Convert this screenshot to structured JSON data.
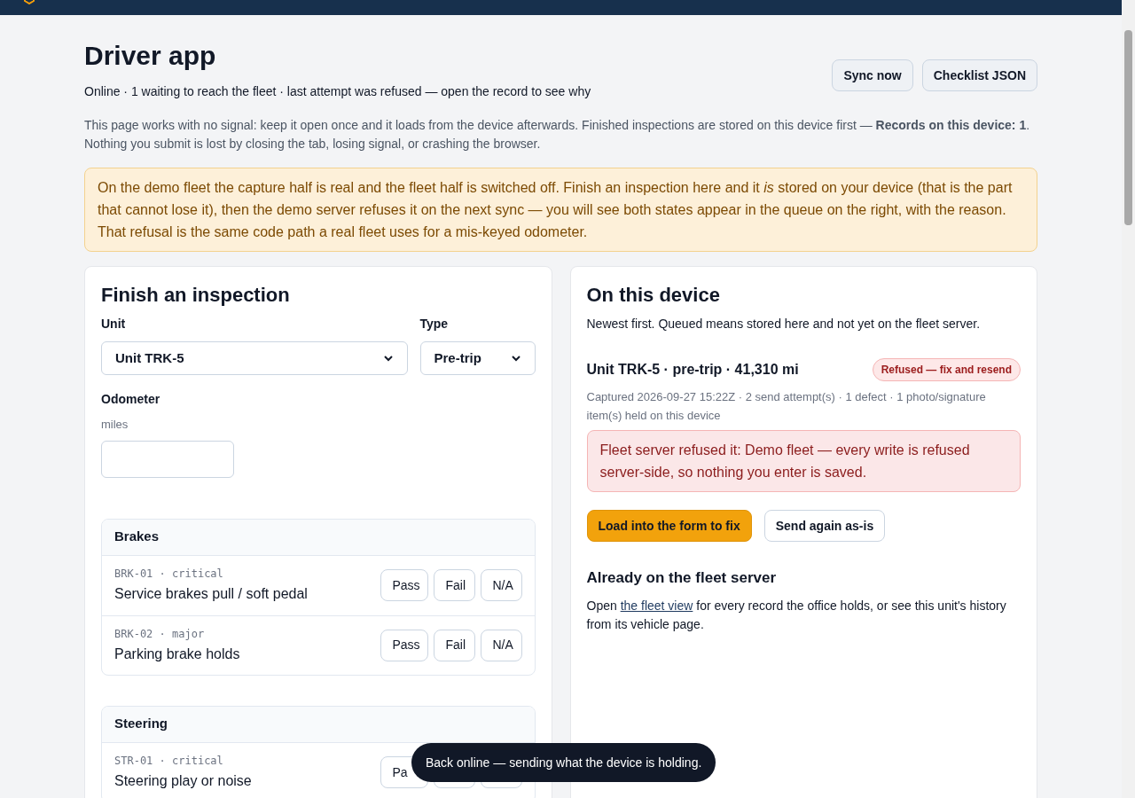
{
  "header": {
    "title": "Driver app",
    "status": "Online · 1 waiting to reach the fleet · last attempt was refused — open the record to see why",
    "actions": [
      "Sync now",
      "Checklist JSON"
    ],
    "info": "This page works with no signal: keep it open once and it loads from the device afterwards. Finished inspections are stored on this device first — **Records on this device: 1**. Nothing you submit is lost by closing the tab, losing signal, or crashing the browser."
  },
  "notice": "On the demo fleet the capture half is real and the fleet half is switched off. Finish an inspection here and it *is* stored on your device (that is the part that cannot lose it), then the demo server refuses it on the next sync — you will see both states appear in the queue on the right, with the reason. That refusal is the same code path a real fleet uses for a mis-keyed odometer.",
  "form": {
    "title": "Finish an inspection",
    "unit": {
      "label": "Unit",
      "value": "Unit TRK-5"
    },
    "type": {
      "label": "Type",
      "value": "Pre-trip"
    },
    "odometer": {
      "label": "Odometer",
      "hint": "miles"
    },
    "sections": [
      {
        "title": "Brakes",
        "items": [
          {
            "code": "BRK-01 · critical",
            "text": "Service brakes pull / soft pedal",
            "options": [
              {
                "label": "Pass",
                "selected": false
              },
              {
                "label": "Fail",
                "selected": false
              },
              {
                "label": "N/A",
                "selected": false
              }
            ]
          },
          {
            "code": "BRK-02 · major",
            "text": "Parking brake holds",
            "options": [
              {
                "label": "Pass",
                "selected": false
              },
              {
                "label": "Fail",
                "selected": false
              },
              {
                "label": "N/A",
                "selected": false
              }
            ]
          }
        ]
      },
      {
        "title": "Steering",
        "items": [
          {
            "code": "STR-01 · critical",
            "text": "Steering play or noise",
            "options": [
              {
                "label": "Pa",
                "selected": false
              },
              {
                "selected": false
              },
              {
                "selected": false
              }
            ]
          }
        ]
      }
    ]
  },
  "device": {
    "title": "On this device",
    "subtitle": "Newest first. Queued means stored here and not yet on the fleet server.",
    "records": [
      {
        "title": "Unit TRK-5 · pre-trip · 41,310 mi",
        "status": "Refused — fix and resend",
        "meta": "Captured 2026-09-27 15:22Z · 2 send attempt(s) · 1 defect · 1 photo/signature item(s) held on this device",
        "error": "Fleet server refused it: Demo fleet — every write is refused server-side, so nothing you enter is saved.",
        "actions": [
          "Load into the form to fix",
          "Send again as-is"
        ]
      }
    ],
    "fleet": {
      "title": "Already on the fleet server",
      "before": "Open ",
      "link": "the fleet view",
      "after": " for every record the office holds, or see this unit's history from its vehicle page."
    }
  },
  "toast": "Back online — sending what the device is holding."
}
